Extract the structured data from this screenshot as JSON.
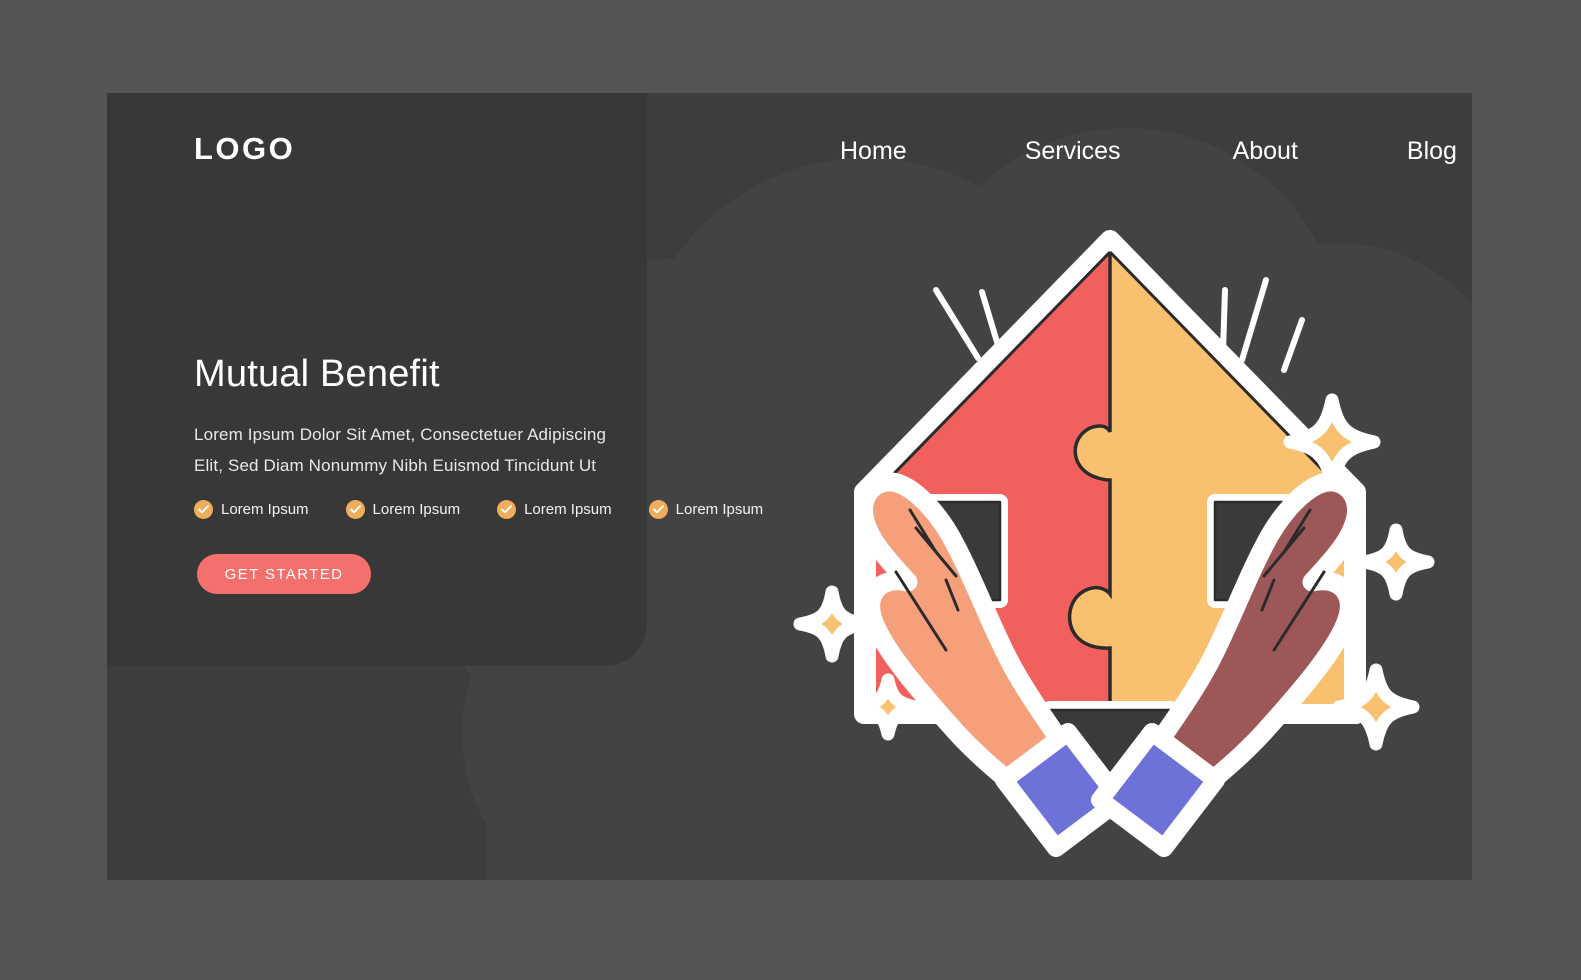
{
  "page": {
    "background_color": "#545454",
    "panel_color": "#3d3d3d",
    "accent_color": "#f4706c",
    "check_color": "#f0ad5c"
  },
  "header": {
    "logo": "LOGO",
    "nav": [
      {
        "label": "Home"
      },
      {
        "label": "Services"
      },
      {
        "label": "About"
      },
      {
        "label": "Blog"
      }
    ]
  },
  "hero": {
    "headline": "Mutual Benefit",
    "subcopy": "Lorem Ipsum Dolor Sit Amet, Consectetuer Adipiscing Elit, Sed Diam Nonummy Nibh Euismod Tincidunt Ut",
    "features": [
      {
        "label": "Lorem Ipsum",
        "icon": "check-circle-icon"
      },
      {
        "label": "Lorem Ipsum",
        "icon": "check-circle-icon"
      },
      {
        "label": "Lorem Ipsum",
        "icon": "check-circle-icon"
      },
      {
        "label": "Lorem Ipsum",
        "icon": "check-circle-icon"
      }
    ],
    "cta_label": "GET STARTED"
  },
  "illustration": {
    "name": "two-hands-holding-house-puzzle",
    "colors": {
      "puzzle_left": "#f2605e",
      "puzzle_right": "#f8c06f",
      "hand_light": "#f5a07b",
      "hand_dark": "#9e5758",
      "cuff": "#6e72d8",
      "outline": "#ffffff",
      "window": "#3a3a3a",
      "sparkle": "#f8c06f"
    },
    "elements": [
      "house-roof-peak",
      "puzzle-piece-left",
      "puzzle-piece-right",
      "window-left",
      "window-right",
      "door",
      "hand-left",
      "hand-right",
      "cuff-left",
      "cuff-right",
      "speed-lines-left",
      "speed-lines-right",
      "sparkle-1",
      "sparkle-2",
      "sparkle-3",
      "sparkle-4",
      "sparkle-5"
    ]
  }
}
